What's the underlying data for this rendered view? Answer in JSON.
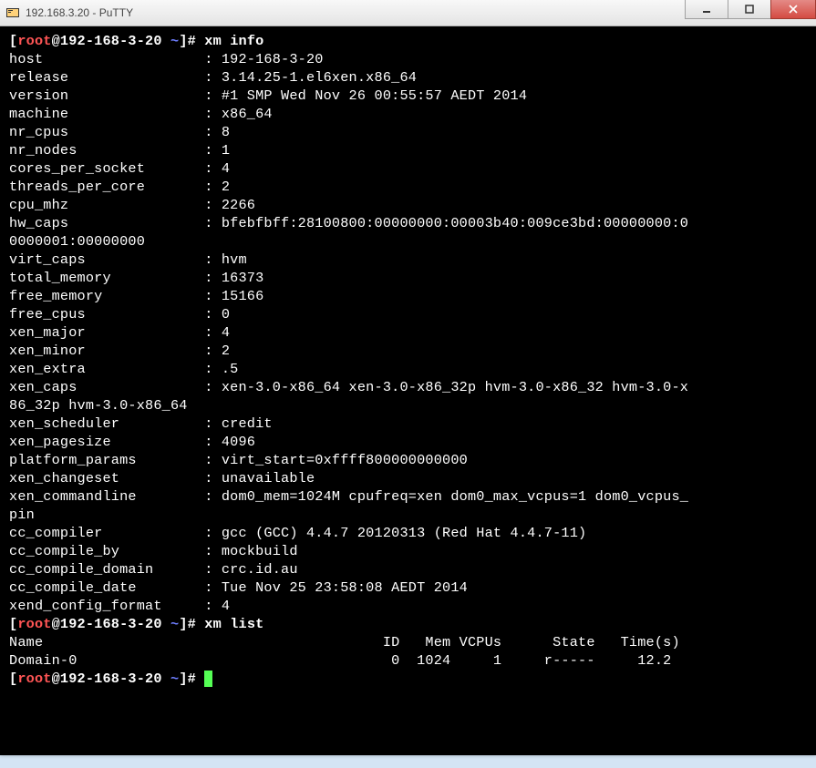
{
  "window": {
    "title": "192.168.3.20 - PuTTY"
  },
  "prompt": {
    "lb": "[",
    "user": "root",
    "at": "@",
    "host": "192-168-3-20 ",
    "path": "~",
    "rb": "]# "
  },
  "cmd1": "xm info",
  "fields": [
    {
      "k": "host",
      "v": "192-168-3-20"
    },
    {
      "k": "release",
      "v": "3.14.25-1.el6xen.x86_64"
    },
    {
      "k": "version",
      "v": "#1 SMP Wed Nov 26 00:55:57 AEDT 2014"
    },
    {
      "k": "machine",
      "v": "x86_64"
    },
    {
      "k": "nr_cpus",
      "v": "8"
    },
    {
      "k": "nr_nodes",
      "v": "1"
    },
    {
      "k": "cores_per_socket",
      "v": "4"
    },
    {
      "k": "threads_per_core",
      "v": "2"
    },
    {
      "k": "cpu_mhz",
      "v": "2266"
    },
    {
      "k": "hw_caps",
      "v": "bfebfbff:28100800:00000000:00003b40:009ce3bd:00000000:0"
    }
  ],
  "hw_caps_wrap": "0000001:00000000",
  "fields2": [
    {
      "k": "virt_caps",
      "v": "hvm"
    },
    {
      "k": "total_memory",
      "v": "16373"
    },
    {
      "k": "free_memory",
      "v": "15166"
    },
    {
      "k": "free_cpus",
      "v": "0"
    },
    {
      "k": "xen_major",
      "v": "4"
    },
    {
      "k": "xen_minor",
      "v": "2"
    },
    {
      "k": "xen_extra",
      "v": ".5"
    },
    {
      "k": "xen_caps",
      "v": "xen-3.0-x86_64 xen-3.0-x86_32p hvm-3.0-x86_32 hvm-3.0-x"
    }
  ],
  "xen_caps_wrap": "86_32p hvm-3.0-x86_64",
  "fields3": [
    {
      "k": "xen_scheduler",
      "v": "credit"
    },
    {
      "k": "xen_pagesize",
      "v": "4096"
    },
    {
      "k": "platform_params",
      "v": "virt_start=0xffff800000000000"
    },
    {
      "k": "xen_changeset",
      "v": "unavailable"
    },
    {
      "k": "xen_commandline",
      "v": "dom0_mem=1024M cpufreq=xen dom0_max_vcpus=1 dom0_vcpus_"
    }
  ],
  "cmdline_wrap": "pin",
  "fields4": [
    {
      "k": "cc_compiler",
      "v": "gcc (GCC) 4.4.7 20120313 (Red Hat 4.4.7-11)"
    },
    {
      "k": "cc_compile_by",
      "v": "mockbuild"
    },
    {
      "k": "cc_compile_domain",
      "v": "crc.id.au"
    },
    {
      "k": "cc_compile_date",
      "v": "Tue Nov 25 23:58:08 AEDT 2014"
    },
    {
      "k": "xend_config_format",
      "v": "4"
    }
  ],
  "cmd2": "xm list",
  "list_header": "Name                                        ID   Mem VCPUs      State   Time(s)",
  "list_row": "Domain-0                                     0  1024     1     r-----     12.2"
}
